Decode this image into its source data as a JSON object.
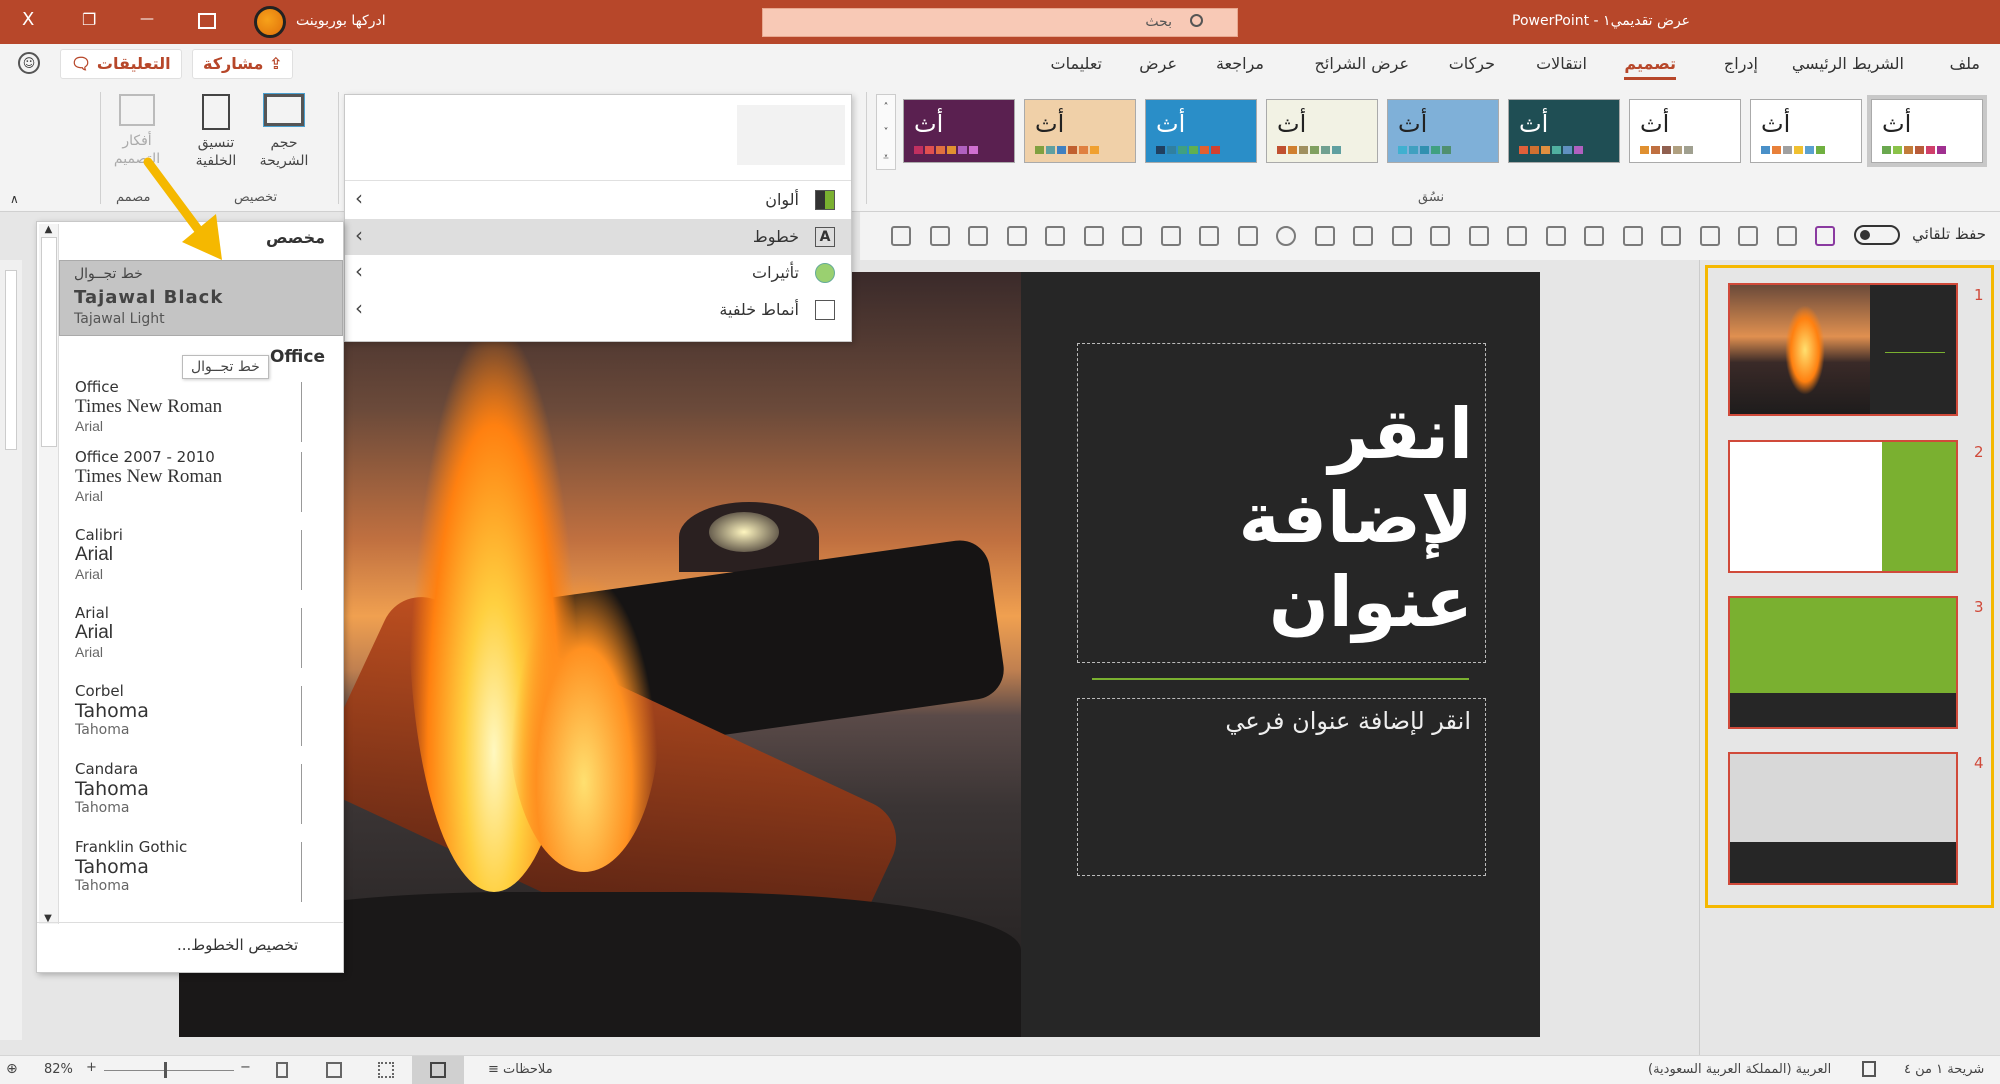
{
  "titlebar": {
    "doc_title": "عرض تقديمي١  -  PowerPoint",
    "search_placeholder": "بحث",
    "user_name": "ادركها بوربوينت",
    "close": "X",
    "restore": "❐",
    "minimize": "—"
  },
  "tabs": [
    "ملف",
    "الشريط الرئيسي",
    "إدراج",
    "تصميم",
    "انتقالات",
    "حركات",
    "عرض الشرائح",
    "مراجعة",
    "عرض",
    "تعليمات"
  ],
  "active_tab": "تصميم",
  "top_buttons": {
    "share": "مشاركة",
    "comments": "التعليقات"
  },
  "ribbon": {
    "slide_size": "حجم الشريحة",
    "format_background": "تنسيق الخلفية",
    "design_ideas": "أفكار التصميم",
    "group_customize": "تخصيص",
    "group_designer": "مصمم",
    "group_themes": "نسُق",
    "theme_glyph": "أث",
    "themes": [
      {
        "bg": "#ffffff",
        "fg": "#222",
        "sw": [
          "#6aa84f",
          "#8bc34a",
          "#c27c3a",
          "#b85c3a",
          "#d0406a",
          "#a03090"
        ]
      },
      {
        "bg": "#ffffff",
        "fg": "#222",
        "sw": [
          "#4a90c8",
          "#e8803a",
          "#a0a0a0",
          "#f0c030",
          "#5aa0d0",
          "#70b040"
        ]
      },
      {
        "bg": "#ffffff",
        "fg": "#222",
        "sw": [
          "#e09030",
          "#c07040",
          "#906050",
          "#b0a080",
          "#a0a090"
        ]
      },
      {
        "bg": "#1f4e54",
        "fg": "#fff",
        "sw": [
          "#e0603a",
          "#d07030",
          "#e09040",
          "#50b0a0",
          "#6090c0",
          "#b060c0"
        ]
      },
      {
        "bg": "#7fb0d8",
        "fg": "#222",
        "sw": [
          "#40b0d0",
          "#40a0c0",
          "#3090b0",
          "#40a080",
          "#509070"
        ]
      },
      {
        "bg": "#f2f2e4",
        "fg": "#222",
        "sw": [
          "#c05030",
          "#d08030",
          "#a09060",
          "#80a060",
          "#70a090",
          "#60a0a0"
        ]
      },
      {
        "bg": "#2a8ec8",
        "fg": "#fff",
        "sw": [
          "#204060",
          "#3080a0",
          "#40a080",
          "#60b050",
          "#e06030",
          "#d04030"
        ]
      },
      {
        "bg": "#f0d0a8",
        "fg": "#222",
        "sw": [
          "#80a040",
          "#60a0a0",
          "#4080c0",
          "#c06030",
          "#e08040",
          "#f0a030"
        ]
      },
      {
        "bg": "#5a2050",
        "fg": "#fff",
        "sw": [
          "#c03060",
          "#e05050",
          "#e07040",
          "#e09030",
          "#b060c0",
          "#d070d0"
        ]
      }
    ]
  },
  "qat": {
    "autosave": "حفظ تلقائي"
  },
  "variants_menu": {
    "items": [
      "ألوان",
      "خطوط",
      "تأثيرات",
      "أنماط خلفية"
    ],
    "highlighted": "خطوط"
  },
  "font_panel": {
    "custom_header": "مخصص",
    "custom_item": {
      "name": "خط تجــوال",
      "heading": "Tajawal Black",
      "body": "Tajawal Light"
    },
    "tooltip": "خط تجــوال",
    "office_header": "Office",
    "items": [
      {
        "name": "Office",
        "heading": "Times New Roman",
        "body": "Arial"
      },
      {
        "name": "Office 2007 - 2010",
        "heading": "Times New Roman",
        "body": "Arial"
      },
      {
        "name": "Calibri",
        "heading": "Arial",
        "body": "Arial"
      },
      {
        "name": "Arial",
        "heading": "Arial",
        "body": "Arial"
      },
      {
        "name": "Corbel",
        "heading": "Tahoma",
        "body": "Tahoma"
      },
      {
        "name": "Candara",
        "heading": "Tahoma",
        "body": "Tahoma"
      },
      {
        "name": "Franklin Gothic",
        "heading": "Tahoma",
        "body": "Tahoma"
      }
    ],
    "customize": "تخصيص الخطوط..."
  },
  "slide": {
    "title": "انقر لإضافة عنوان",
    "subtitle": "انقر لإضافة عنوان فرعي"
  },
  "thumbnails": [
    "1",
    "2",
    "3",
    "4"
  ],
  "status": {
    "slide_info": "شريحة ١ من ٤",
    "language": "العربية (المملكة العربية السعودية)",
    "notes": "ملاحظات",
    "zoom": "82%",
    "zoom_level": 82
  },
  "colors": {
    "brand": "#b7472a",
    "highlight": "#f5b800",
    "slide_dark": "#262626",
    "green": "#7ab030"
  }
}
